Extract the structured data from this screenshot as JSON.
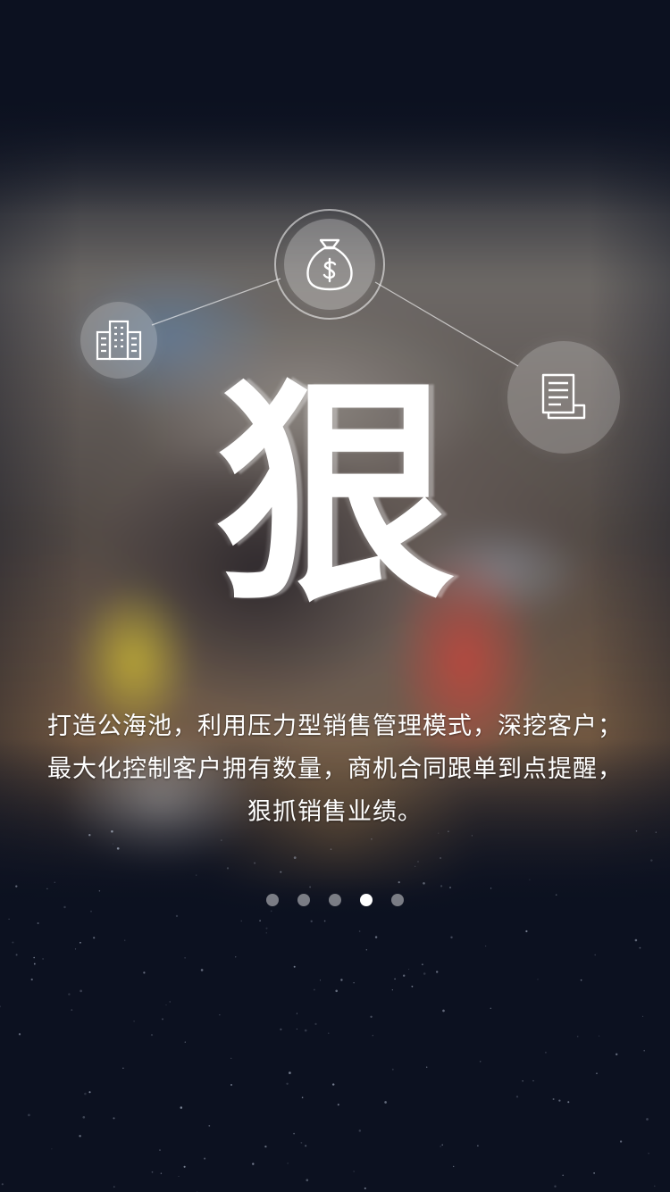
{
  "slide": {
    "hero_character": "狠",
    "description_lines": [
      "打造公海池，利用压力型销售管理模式，深挖客户；",
      "最大化控制客户拥有数量，商机合同跟单到点提醒，",
      "狠抓销售业绩。"
    ]
  },
  "icons": {
    "top": "money-bag-icon",
    "left": "building-icon",
    "right": "document-icon"
  },
  "pager": {
    "total_pages": 5,
    "current_page": 4
  },
  "colors": {
    "background": "#0c1120",
    "text": "#ffffff",
    "dot_inactive": "rgba(255,255,255,0.45)",
    "dot_active": "#ffffff"
  }
}
